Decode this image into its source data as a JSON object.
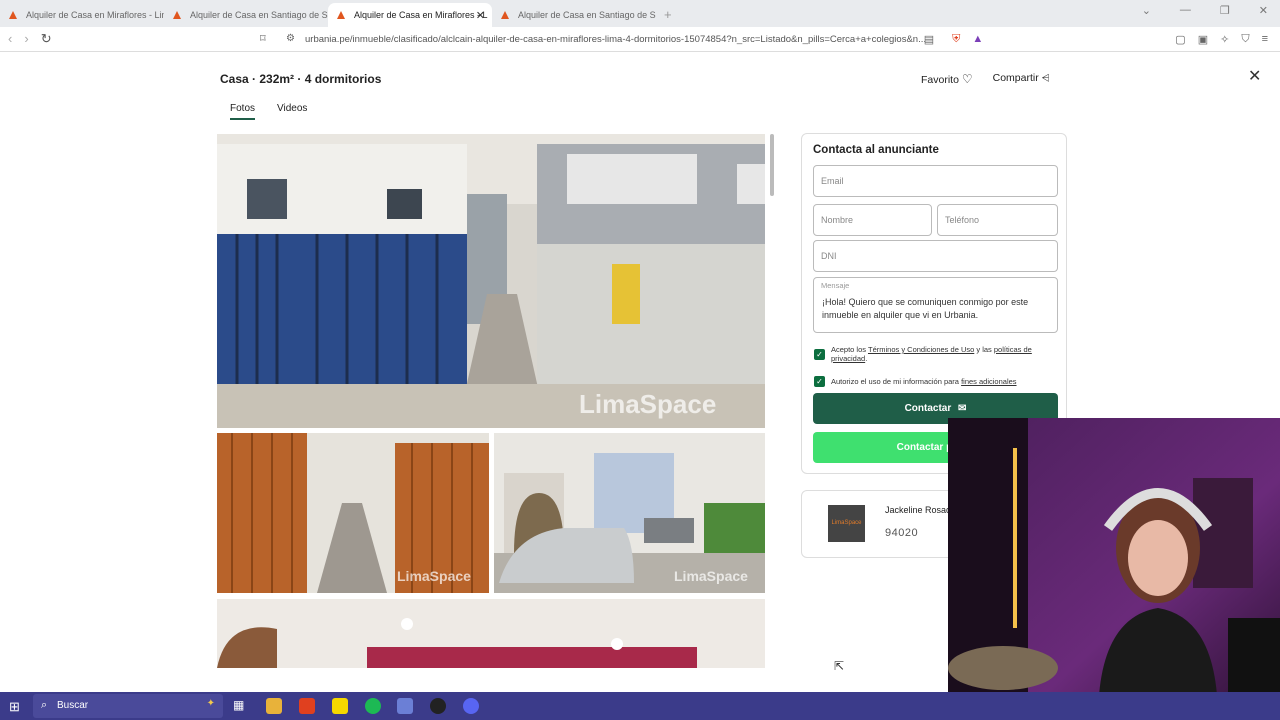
{
  "browser": {
    "tabs": [
      {
        "title": "Alquiler de Casa en Miraflores - Lima"
      },
      {
        "title": "Alquiler de Casa en Santiago de Surco"
      },
      {
        "title": "Alquiler de Casa en Miraflores - L"
      },
      {
        "title": "Alquiler de Casa en Santiago de Surco"
      }
    ],
    "new_tab": "+",
    "url": "urbania.pe/inmueble/clasificado/alclcain-alquiler-de-casa-en-miraflores-lima-4-dormitorios-15074854?n_src=Listado&n_pills=Cerca+a+colegios&n..."
  },
  "listing": {
    "title": "Casa · 232m² · 4 dormitorios",
    "favorite_label": "Favorito",
    "share_label": "Compartir",
    "media_tabs": [
      {
        "label": "Fotos"
      },
      {
        "label": "Videos"
      }
    ],
    "watermark": "LimaSpace"
  },
  "contact_form": {
    "heading": "Contacta al anunciante",
    "email_placeholder": "Email",
    "name_placeholder": "Nombre",
    "phone_placeholder": "Teléfono",
    "dni_placeholder": "DNI",
    "message_label": "Mensaje",
    "message_value": "¡Hola! Quiero que se comuniquen conmigo por este inmueble en alquiler que vi en Urbania.",
    "terms_prefix": "Acepto los ",
    "terms_link": "Términos y Condiciones de Uso",
    "terms_mid": " y las ",
    "privacy_link": "políticas de privacidad",
    "terms_suffix": ".",
    "authorize_prefix": "Autorizo el uso de mi información para ",
    "authorize_link": "fines adicionales",
    "contact_button": "Contactar",
    "whatsapp_button": "Contactar por W"
  },
  "agent": {
    "name": "Jackeline Rosad",
    "phone": "94020",
    "logo_text": "LimaSpace"
  },
  "taskbar": {
    "search_label": "Buscar"
  },
  "colors": {
    "brand_green": "#1f5e48",
    "whatsapp_green": "#3fe06f",
    "checkbox_green": "#0c6e3f"
  }
}
